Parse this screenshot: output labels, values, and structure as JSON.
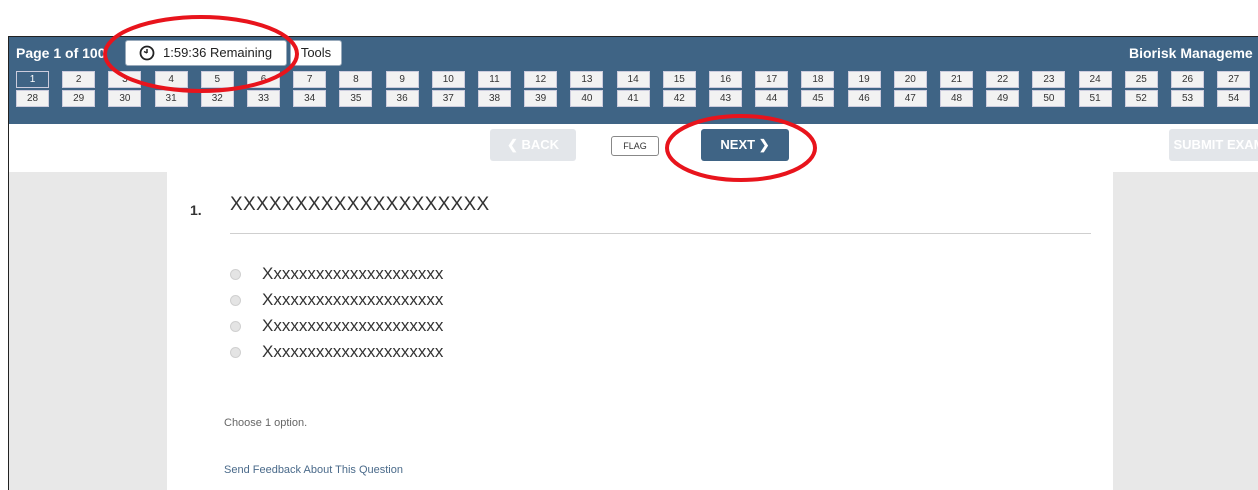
{
  "header": {
    "page_label": "Page 1 of 100",
    "timer": "1:59:36 Remaining",
    "tools_label": "Tools",
    "exam_name": "Biorisk Manageme"
  },
  "question_nav": {
    "current": "1",
    "row1": [
      "1",
      "2",
      "3",
      "4",
      "5",
      "6",
      "7",
      "8",
      "9",
      "10",
      "11",
      "12",
      "13",
      "14",
      "15",
      "16",
      "17",
      "18",
      "19",
      "20",
      "21",
      "22",
      "23",
      "24",
      "25",
      "26",
      "27"
    ],
    "row2": [
      "28",
      "29",
      "30",
      "31",
      "32",
      "33",
      "34",
      "35",
      "36",
      "37",
      "38",
      "39",
      "40",
      "41",
      "42",
      "43",
      "44",
      "45",
      "46",
      "47",
      "48",
      "49",
      "50",
      "51",
      "52",
      "53",
      "54"
    ]
  },
  "controls": {
    "back_label": "BACK",
    "flag_label": "FLAG",
    "next_label": "NEXT",
    "submit_label": "SUBMIT EXAM"
  },
  "question": {
    "number": "1.",
    "text": "XXXXXXXXXXXXXXXXXXXX",
    "options": [
      "Xxxxxxxxxxxxxxxxxxxxx",
      "Xxxxxxxxxxxxxxxxxxxxx",
      "Xxxxxxxxxxxxxxxxxxxxx",
      "Xxxxxxxxxxxxxxxxxxxxx"
    ],
    "hint": "Choose 1 option.",
    "feedback_link": "Send Feedback About This Question"
  },
  "colors": {
    "header_bg": "#3f6485",
    "annotation_red": "#e8141c"
  }
}
